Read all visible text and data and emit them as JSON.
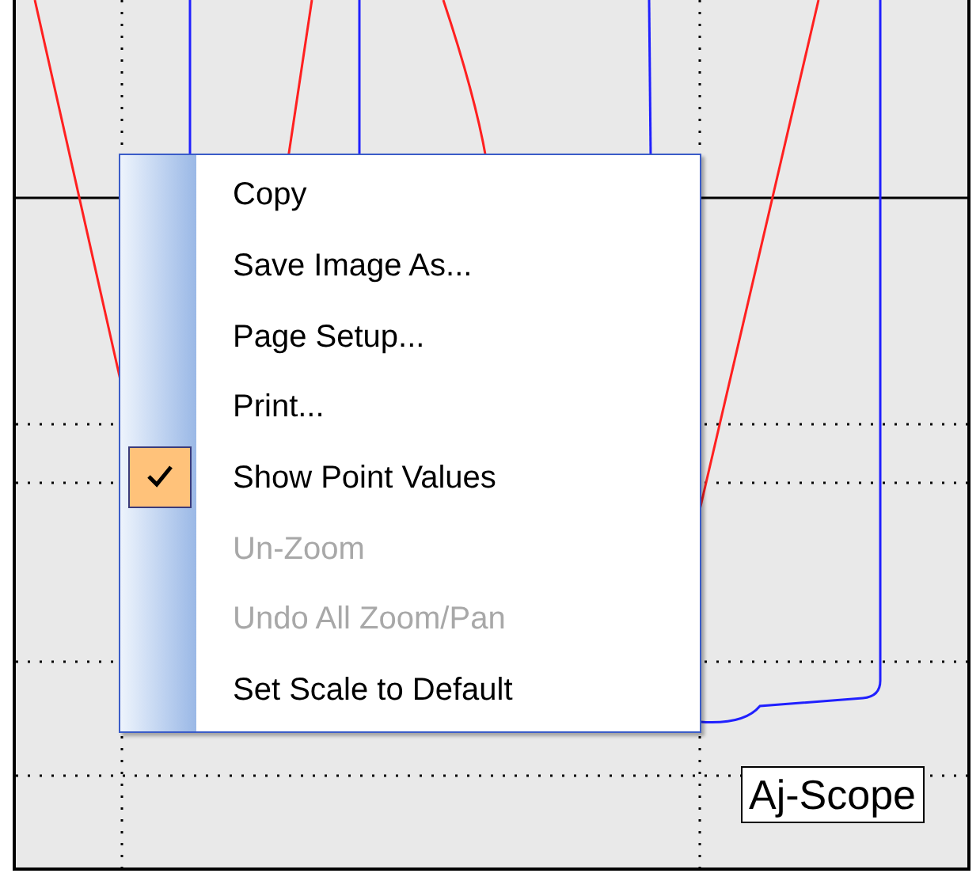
{
  "menu": {
    "items": [
      {
        "label": "Copy",
        "checked": false,
        "disabled": false
      },
      {
        "label": "Save Image As...",
        "checked": false,
        "disabled": false
      },
      {
        "label": "Page Setup...",
        "checked": false,
        "disabled": false
      },
      {
        "label": "Print...",
        "checked": false,
        "disabled": false
      },
      {
        "label": "Show Point Values",
        "checked": true,
        "disabled": false
      },
      {
        "label": "Un-Zoom",
        "checked": false,
        "disabled": true
      },
      {
        "label": "Undo All Zoom/Pan",
        "checked": false,
        "disabled": true
      },
      {
        "label": "Set Scale to Default",
        "checked": false,
        "disabled": false
      }
    ]
  },
  "legend": {
    "label": "Aj-Scope"
  }
}
